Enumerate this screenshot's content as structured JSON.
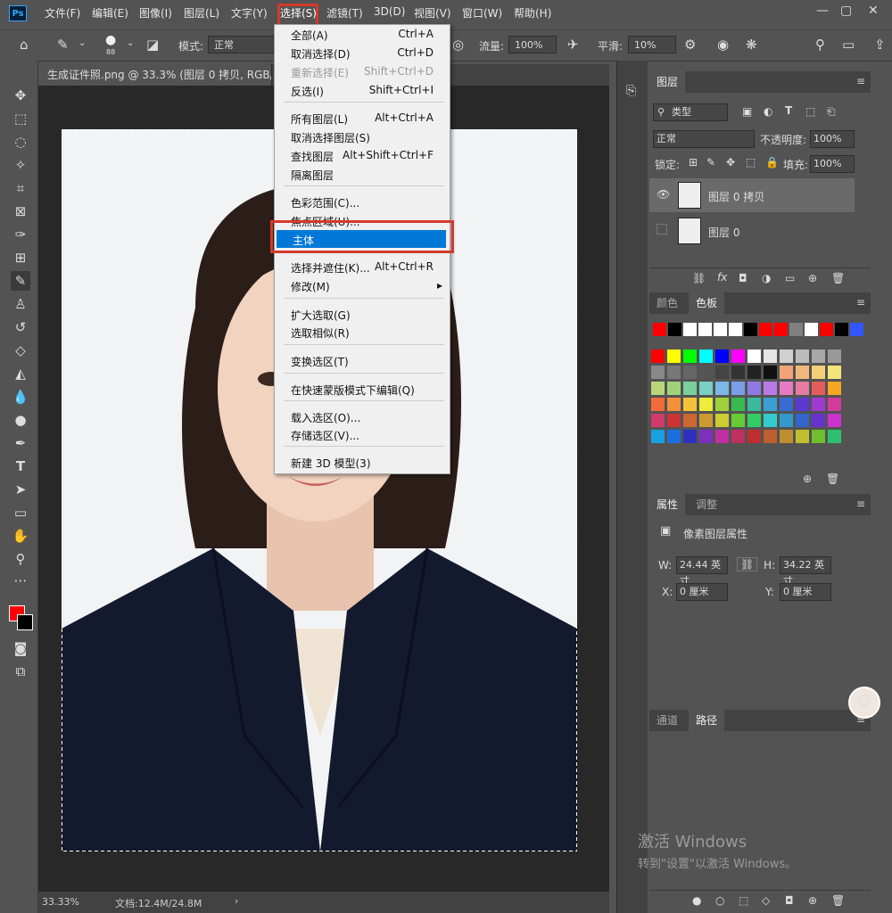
{
  "app": {
    "logo": "Ps"
  },
  "menubar": {
    "items": [
      "文件(F)",
      "编辑(E)",
      "图像(I)",
      "图层(L)",
      "文字(Y)",
      "选择(S)",
      "滤镜(T)",
      "3D(D)",
      "视图(V)",
      "窗口(W)",
      "帮助(H)"
    ],
    "window_controls": [
      "—",
      "▢",
      "✕"
    ]
  },
  "options_bar": {
    "brush_size": "88",
    "mode_label": "模式:",
    "mode_value": "正常",
    "flow_label": "流量:",
    "flow_value": "100%",
    "smooth_label": "平滑:",
    "smooth_value": "10%"
  },
  "document": {
    "tab_title": "生成证件照.png @ 33.3% (图层 0 拷贝, RGB/8)",
    "zoom": "33.33%",
    "doc_size": "文档:12.4M/24.8M"
  },
  "select_menu": {
    "items": [
      {
        "label": "全部(A)",
        "shortcut": "Ctrl+A"
      },
      {
        "label": "取消选择(D)",
        "shortcut": "Ctrl+D"
      },
      {
        "label": "重新选择(E)",
        "shortcut": "Shift+Ctrl+D"
      },
      {
        "label": "反选(I)",
        "shortcut": "Shift+Ctrl+I"
      },
      {
        "label": "所有图层(L)",
        "shortcut": "Alt+Ctrl+A"
      },
      {
        "label": "取消选择图层(S)",
        "shortcut": ""
      },
      {
        "label": "查找图层",
        "shortcut": "Alt+Shift+Ctrl+F"
      },
      {
        "label": "隔离图层",
        "shortcut": ""
      },
      {
        "label": "色彩范围(C)...",
        "shortcut": ""
      },
      {
        "label": "焦点区域(U)...",
        "shortcut": ""
      },
      {
        "label": "主体",
        "shortcut": ""
      },
      {
        "label": "选择并遮住(K)...",
        "shortcut": "Alt+Ctrl+R"
      },
      {
        "label": "修改(M)",
        "shortcut": "▸"
      },
      {
        "label": "扩大选取(G)",
        "shortcut": ""
      },
      {
        "label": "选取相似(R)",
        "shortcut": ""
      },
      {
        "label": "变换选区(T)",
        "shortcut": ""
      },
      {
        "label": "在快速蒙版模式下编辑(Q)",
        "shortcut": ""
      },
      {
        "label": "载入选区(O)...",
        "shortcut": ""
      },
      {
        "label": "存储选区(V)...",
        "shortcut": ""
      },
      {
        "label": "新建 3D 模型(3)",
        "shortcut": ""
      }
    ]
  },
  "layers_panel": {
    "tab": "图层",
    "filter_kind": "类型",
    "blend_mode": "正常",
    "opacity_label": "不透明度:",
    "opacity_value": "100%",
    "lock_label": "锁定:",
    "fill_label": "填充:",
    "fill_value": "100%",
    "layers": [
      {
        "name": "图层 0 拷贝",
        "visible": true,
        "selected": true
      },
      {
        "name": "图层 0",
        "visible": false,
        "selected": false
      }
    ]
  },
  "swatches_panel": {
    "tabs": [
      "颜色",
      "色板"
    ],
    "recent": [
      "#ff0000",
      "#000000",
      "#ffffff",
      "#ffffff",
      "#ffffff",
      "#ffffff",
      "#000000",
      "#ff0000",
      "#ff0000",
      "#808080",
      "#ffffff",
      "#ff0000",
      "#000000",
      "#3355ff"
    ],
    "grid": [
      [
        "#ff0000",
        "#ffff00",
        "#00ff00",
        "#00ffff",
        "#0000ff",
        "#ff00ff",
        "#ffffff",
        "#e6e6e6",
        "#d0d0d0",
        "#bcbcbc",
        "#a8a8a8",
        "#999999"
      ],
      [
        "#888888",
        "#777777",
        "#666666",
        "#555555",
        "#444444",
        "#333333",
        "#222222",
        "#111111",
        "#f2a37a",
        "#f2b77a",
        "#f2d07a",
        "#f2e57a"
      ],
      [
        "#b9d77a",
        "#9fd37a",
        "#7acf9a",
        "#7acfc3",
        "#7ab9e6",
        "#7a9fe6",
        "#8f7ae6",
        "#b97ae6",
        "#e67ac3",
        "#e67a9f",
        "#e65c5c",
        "#f5a623"
      ],
      [
        "#f26b3a",
        "#f2913a",
        "#f2c23a",
        "#ecec3a",
        "#9fd23a",
        "#3ab94f",
        "#3ab99f",
        "#3a9fd2",
        "#3a6bd2",
        "#5c3ad2",
        "#9f3ad2",
        "#d23a9f"
      ],
      [
        "#d23a6b",
        "#cc3333",
        "#cc6633",
        "#cc9933",
        "#cccc33",
        "#66cc33",
        "#33cc66",
        "#33cccc",
        "#3399cc",
        "#3366cc",
        "#6633cc",
        "#cc33cc"
      ],
      [
        "#1a9fe0",
        "#1a6fe0",
        "#2f2fbf",
        "#7f2fbf",
        "#bf2f9f",
        "#bf2f5f",
        "#bf2f2f",
        "#bf5f2f",
        "#bf8f2f",
        "#bfbf2f",
        "#6fbf2f",
        "#2fbf6f"
      ]
    ]
  },
  "properties_panel": {
    "tabs": [
      "属性",
      "调整"
    ],
    "title": "像素图层属性",
    "w_label": "W:",
    "w_value": "24.44 英寸",
    "h_label": "H:",
    "h_value": "34.22 英寸",
    "x_label": "X:",
    "x_value": "0 厘米",
    "y_label": "Y:",
    "y_value": "0 厘米"
  },
  "paths_panel": {
    "tabs": [
      "通道",
      "路径"
    ]
  },
  "watermark": {
    "line1": "激活 Windows",
    "line2": "转到\"设置\"以激活 Windows。"
  }
}
